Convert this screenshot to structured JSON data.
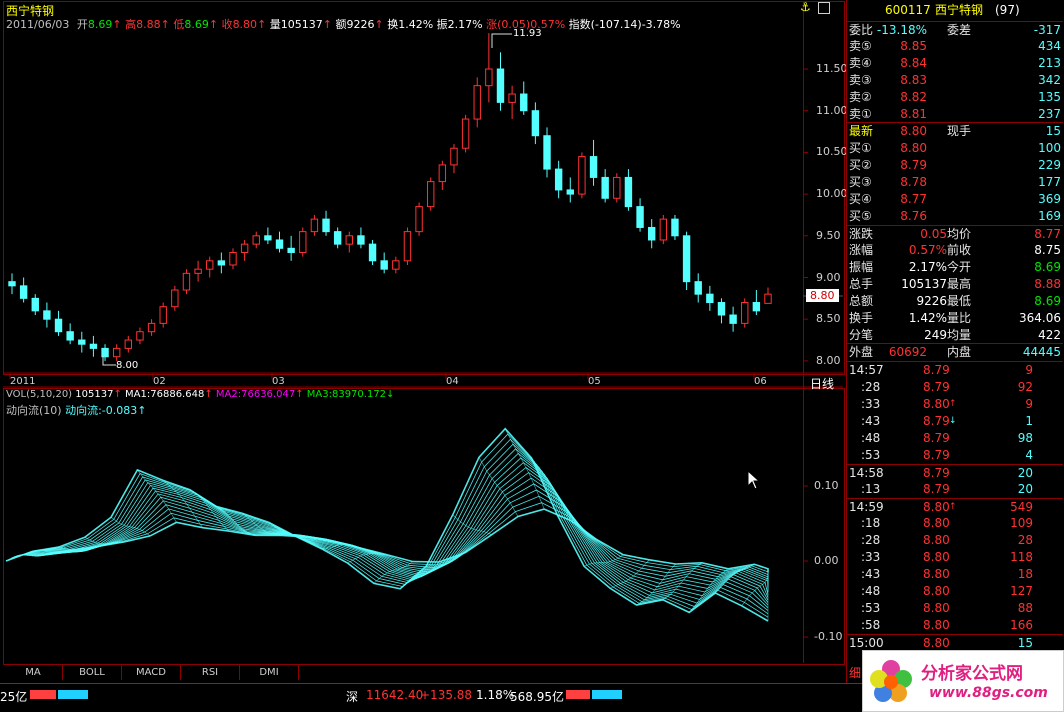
{
  "stock": {
    "code": "600117",
    "name": "西宁特钢",
    "rank": "(97)",
    "title_name": "西宁特钢"
  },
  "header": {
    "date": "2011/06/03",
    "open_label": "开",
    "open": "8.69",
    "high_label": "高",
    "high": "8.88",
    "low_label": "低",
    "low": "8.69",
    "close_label": "收",
    "close": "8.80",
    "vol_label": "量",
    "vol": "105137",
    "amount_label": "额",
    "amount": "9226",
    "turnover_label": "换",
    "turnover": "1.42%",
    "amp_label": "振",
    "amp": "2.17%",
    "chg_label": "涨",
    "chg": "(0.05)",
    "chg_pct": "0.57%",
    "index_label": "指数",
    "index": "(-107.14)-3.78%"
  },
  "price_axis": [
    "11.50",
    "11.00",
    "10.50",
    "10.00",
    "9.50",
    "9.00",
    "8.50",
    "8.00"
  ],
  "current_price_tag": "8.80",
  "annotations": {
    "max": "11.93",
    "min": "8.00"
  },
  "time_axis": [
    "2011",
    "02",
    "03",
    "04",
    "05",
    "06"
  ],
  "period_label": "日线",
  "vol_line": {
    "name": "VOL(5,10,20)",
    "vol": "105137",
    "ma1": "MA1:76886.648",
    "ma2": "MA2:76636.047",
    "ma3": "MA3:83970.172"
  },
  "indicator": {
    "name": "动向流(10)",
    "value": "动向流:-0.083",
    "axis": [
      "0.10",
      "0.00",
      "-0.10"
    ]
  },
  "tabs": [
    "MA",
    "BOLL",
    "MACD",
    "RSI",
    "DMI"
  ],
  "panel": {
    "weibi_label": "委比",
    "weibi": "-13.18%",
    "weicha_label": "委差",
    "weicha": "-317",
    "asks": [
      {
        "label": "卖⑤",
        "price": "8.85",
        "vol": "434"
      },
      {
        "label": "卖④",
        "price": "8.84",
        "vol": "213"
      },
      {
        "label": "卖③",
        "price": "8.83",
        "vol": "342"
      },
      {
        "label": "卖②",
        "price": "8.82",
        "vol": "135"
      },
      {
        "label": "卖①",
        "price": "8.81",
        "vol": "237"
      }
    ],
    "last_label": "最新",
    "last": "8.80",
    "xianshou_label": "现手",
    "xianshou": "15",
    "bids": [
      {
        "label": "买①",
        "price": "8.80",
        "vol": "100"
      },
      {
        "label": "买②",
        "price": "8.79",
        "vol": "229"
      },
      {
        "label": "买③",
        "price": "8.78",
        "vol": "177"
      },
      {
        "label": "买④",
        "price": "8.77",
        "vol": "369"
      },
      {
        "label": "买⑤",
        "price": "8.76",
        "vol": "169"
      }
    ],
    "stats": [
      {
        "l1": "涨跌",
        "v1": "0.05",
        "l2": "均价",
        "v2": "8.77",
        "c1": "red",
        "c2": "red"
      },
      {
        "l1": "涨幅",
        "v1": "0.57%",
        "l2": "前收",
        "v2": "8.75",
        "c1": "red",
        "c2": "wht"
      },
      {
        "l1": "振幅",
        "v1": "2.17%",
        "l2": "今开",
        "v2": "8.69",
        "c1": "wht",
        "c2": "grn"
      },
      {
        "l1": "总手",
        "v1": "105137",
        "l2": "最高",
        "v2": "8.88",
        "c1": "wht",
        "c2": "red"
      },
      {
        "l1": "总额",
        "v1": "9226",
        "l2": "最低",
        "v2": "8.69",
        "c1": "wht",
        "c2": "grn"
      },
      {
        "l1": "换手",
        "v1": "1.42%",
        "l2": "量比",
        "v2": "364.06",
        "c1": "wht",
        "c2": "wht"
      },
      {
        "l1": "分笔",
        "v1": "249",
        "l2": "均量",
        "v2": "422",
        "c1": "wht",
        "c2": "wht"
      }
    ],
    "waipan_label": "外盘",
    "waipan": "60692",
    "neipan_label": "内盘",
    "neipan": "44445",
    "ticks": [
      {
        "t": "14:57",
        "p": "8.79",
        "v": "9",
        "arrow": "",
        "vc": "red"
      },
      {
        "t": ":28",
        "p": "8.79",
        "v": "92",
        "arrow": "",
        "vc": "red"
      },
      {
        "t": ":33",
        "p": "8.80",
        "v": "9",
        "arrow": "↑",
        "vc": "red"
      },
      {
        "t": ":43",
        "p": "8.79",
        "v": "1",
        "arrow": "↓",
        "vc": "cyan"
      },
      {
        "t": ":48",
        "p": "8.79",
        "v": "98",
        "arrow": "",
        "vc": "cyan"
      },
      {
        "t": ":53",
        "p": "8.79",
        "v": "4",
        "arrow": "",
        "vc": "cyan"
      },
      {
        "t": "14:58",
        "p": "8.79",
        "v": "20",
        "arrow": "",
        "vc": "cyan"
      },
      {
        "t": ":13",
        "p": "8.79",
        "v": "20",
        "arrow": "",
        "vc": "cyan"
      },
      {
        "t": "14:59",
        "p": "8.80",
        "v": "549",
        "arrow": "↑",
        "vc": "red"
      },
      {
        "t": ":18",
        "p": "8.80",
        "v": "109",
        "arrow": "",
        "vc": "red"
      },
      {
        "t": ":28",
        "p": "8.80",
        "v": "28",
        "arrow": "",
        "vc": "red"
      },
      {
        "t": ":33",
        "p": "8.80",
        "v": "118",
        "arrow": "",
        "vc": "red"
      },
      {
        "t": ":43",
        "p": "8.80",
        "v": "18",
        "arrow": "",
        "vc": "red"
      },
      {
        "t": ":48",
        "p": "8.80",
        "v": "127",
        "arrow": "",
        "vc": "red"
      },
      {
        "t": ":53",
        "p": "8.80",
        "v": "88",
        "arrow": "",
        "vc": "red"
      },
      {
        "t": ":58",
        "p": "8.80",
        "v": "166",
        "arrow": "",
        "vc": "red"
      },
      {
        "t": "15:00",
        "p": "8.80",
        "v": "15",
        "arrow": "",
        "vc": "cyan"
      }
    ],
    "bottom_tab": "细"
  },
  "statusbar": {
    "left_amount": "25亿",
    "sz_label": "深",
    "sz_index": "11642.40",
    "sz_change": "+135.88",
    "sz_pct": "1.18%",
    "sz_amount": "568.95亿"
  },
  "watermark": {
    "site": "分析家公式网",
    "url": "www.88gs.com"
  },
  "chart_data": {
    "type": "candlestick",
    "ohlc_note": "approximate daily candles read from chart",
    "y_range": [
      7.9,
      12.0
    ],
    "candles": [
      [
        8.95,
        9.05,
        8.8,
        8.9
      ],
      [
        8.9,
        9.0,
        8.7,
        8.75
      ],
      [
        8.75,
        8.8,
        8.55,
        8.6
      ],
      [
        8.6,
        8.7,
        8.4,
        8.5
      ],
      [
        8.5,
        8.6,
        8.3,
        8.35
      ],
      [
        8.35,
        8.45,
        8.2,
        8.25
      ],
      [
        8.25,
        8.35,
        8.1,
        8.2
      ],
      [
        8.2,
        8.3,
        8.05,
        8.15
      ],
      [
        8.15,
        8.2,
        8.0,
        8.05
      ],
      [
        8.05,
        8.2,
        8.0,
        8.15
      ],
      [
        8.15,
        8.3,
        8.1,
        8.25
      ],
      [
        8.25,
        8.4,
        8.2,
        8.35
      ],
      [
        8.35,
        8.5,
        8.3,
        8.45
      ],
      [
        8.45,
        8.7,
        8.4,
        8.65
      ],
      [
        8.65,
        8.9,
        8.6,
        8.85
      ],
      [
        8.85,
        9.1,
        8.8,
        9.05
      ],
      [
        9.05,
        9.2,
        8.95,
        9.1
      ],
      [
        9.1,
        9.25,
        9.0,
        9.2
      ],
      [
        9.2,
        9.3,
        9.05,
        9.15
      ],
      [
        9.15,
        9.35,
        9.1,
        9.3
      ],
      [
        9.3,
        9.45,
        9.2,
        9.4
      ],
      [
        9.4,
        9.55,
        9.35,
        9.5
      ],
      [
        9.5,
        9.6,
        9.4,
        9.45
      ],
      [
        9.45,
        9.55,
        9.3,
        9.35
      ],
      [
        9.35,
        9.5,
        9.2,
        9.3
      ],
      [
        9.3,
        9.6,
        9.25,
        9.55
      ],
      [
        9.55,
        9.75,
        9.5,
        9.7
      ],
      [
        9.7,
        9.8,
        9.5,
        9.55
      ],
      [
        9.55,
        9.6,
        9.35,
        9.4
      ],
      [
        9.4,
        9.55,
        9.3,
        9.5
      ],
      [
        9.5,
        9.6,
        9.35,
        9.4
      ],
      [
        9.4,
        9.45,
        9.15,
        9.2
      ],
      [
        9.2,
        9.3,
        9.05,
        9.1
      ],
      [
        9.1,
        9.25,
        9.05,
        9.2
      ],
      [
        9.2,
        9.6,
        9.15,
        9.55
      ],
      [
        9.55,
        9.9,
        9.5,
        9.85
      ],
      [
        9.85,
        10.2,
        9.8,
        10.15
      ],
      [
        10.15,
        10.4,
        10.05,
        10.35
      ],
      [
        10.35,
        10.6,
        10.25,
        10.55
      ],
      [
        10.55,
        10.95,
        10.5,
        10.9
      ],
      [
        10.9,
        11.4,
        10.8,
        11.3
      ],
      [
        11.3,
        11.93,
        11.1,
        11.5
      ],
      [
        11.5,
        11.7,
        11.0,
        11.1
      ],
      [
        11.1,
        11.3,
        10.9,
        11.2
      ],
      [
        11.2,
        11.35,
        10.95,
        11.0
      ],
      [
        11.0,
        11.1,
        10.6,
        10.7
      ],
      [
        10.7,
        10.8,
        10.2,
        10.3
      ],
      [
        10.3,
        10.4,
        9.95,
        10.05
      ],
      [
        10.05,
        10.2,
        9.9,
        10.0
      ],
      [
        10.0,
        10.5,
        9.95,
        10.45
      ],
      [
        10.45,
        10.65,
        10.1,
        10.2
      ],
      [
        10.2,
        10.3,
        9.9,
        9.95
      ],
      [
        9.95,
        10.25,
        9.9,
        10.2
      ],
      [
        10.2,
        10.3,
        9.8,
        9.85
      ],
      [
        9.85,
        9.95,
        9.55,
        9.6
      ],
      [
        9.6,
        9.7,
        9.35,
        9.45
      ],
      [
        9.45,
        9.75,
        9.4,
        9.7
      ],
      [
        9.7,
        9.75,
        9.45,
        9.5
      ],
      [
        9.5,
        9.55,
        8.85,
        8.95
      ],
      [
        8.95,
        9.05,
        8.7,
        8.8
      ],
      [
        8.8,
        8.9,
        8.6,
        8.7
      ],
      [
        8.7,
        8.75,
        8.45,
        8.55
      ],
      [
        8.55,
        8.65,
        8.35,
        8.45
      ],
      [
        8.45,
        8.75,
        8.4,
        8.7
      ],
      [
        8.7,
        8.85,
        8.55,
        8.6
      ],
      [
        8.69,
        8.88,
        8.69,
        8.8
      ]
    ],
    "indicator_y_range": [
      -0.12,
      0.12
    ],
    "indicator_value": -0.083
  }
}
